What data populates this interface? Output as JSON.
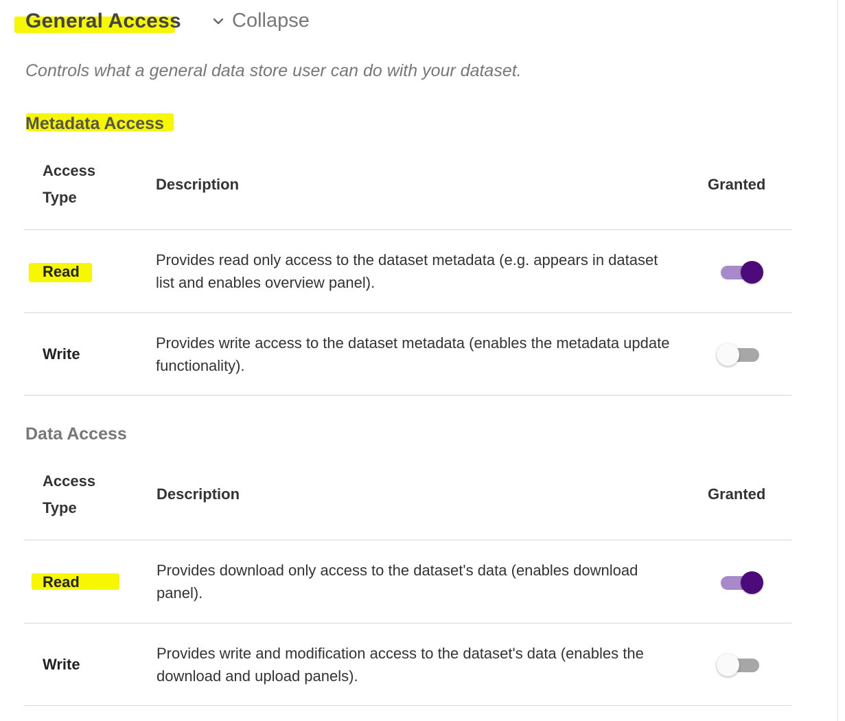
{
  "header": {
    "title": "General Access",
    "collapse_label": "Collapse",
    "description": "Controls what a general data store user can do with your dataset."
  },
  "metadata_access": {
    "heading": "Metadata Access",
    "columns": {
      "access_type_line1": "Access",
      "access_type_line2": "Type",
      "description": "Description",
      "granted": "Granted"
    },
    "rows": [
      {
        "type": "Read",
        "description": "Provides read only access to the dataset metadata (e.g. appears in dataset list and enables overview panel).",
        "granted": true
      },
      {
        "type": "Write",
        "description": "Provides write access to the dataset metadata (enables the metadata update functionality).",
        "granted": false
      }
    ]
  },
  "data_access": {
    "heading": "Data Access",
    "columns": {
      "access_type_line1": "Access",
      "access_type_line2": "Type",
      "description": "Description",
      "granted": "Granted"
    },
    "rows": [
      {
        "type": "Read",
        "description": "Provides download only access to the dataset's data (enables download panel).",
        "granted": true
      },
      {
        "type": "Write",
        "description": "Provides write and modification access to the dataset's data (enables the download and upload panels).",
        "granted": false
      }
    ]
  },
  "colors": {
    "highlight": "#f7f700",
    "toggle_on_thumb": "#4d0a7a",
    "toggle_on_track": "#a889c9",
    "toggle_off_track": "#a7a7a7"
  }
}
